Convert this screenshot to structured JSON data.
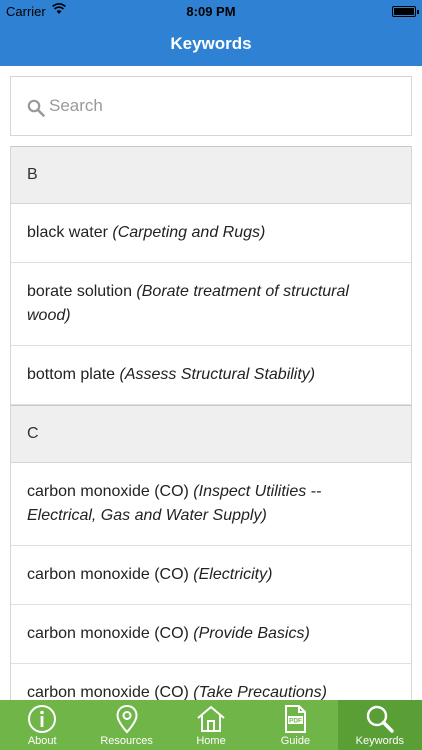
{
  "status_bar": {
    "carrier": "Carrier",
    "time": "8:09 PM"
  },
  "nav": {
    "title": "Keywords"
  },
  "search": {
    "placeholder": "Search"
  },
  "sections": [
    {
      "letter": "B",
      "rows": [
        {
          "term": "black water",
          "context": "(Carpeting and Rugs)"
        },
        {
          "term": "borate solution",
          "context": "(Borate treatment of structural wood)"
        },
        {
          "term": "bottom plate",
          "context": "(Assess Structural Stability)"
        }
      ]
    },
    {
      "letter": "C",
      "rows": [
        {
          "term": "carbon monoxide (CO)",
          "context": "(Inspect Utilities -- Electrical, Gas and Water Supply)"
        },
        {
          "term": "carbon monoxide (CO)",
          "context": "(Electricity)"
        },
        {
          "term": "carbon monoxide (CO)",
          "context": "(Provide Basics)"
        },
        {
          "term": "carbon monoxide (CO)",
          "context": "(Take Precautions)"
        }
      ]
    }
  ],
  "tabs": [
    {
      "label": "About",
      "icon": "info-icon"
    },
    {
      "label": "Resources",
      "icon": "map-pin-icon"
    },
    {
      "label": "Home",
      "icon": "home-icon"
    },
    {
      "label": "Guide",
      "icon": "pdf-icon"
    },
    {
      "label": "Keywords",
      "icon": "search-icon",
      "active": true
    }
  ],
  "colors": {
    "nav": "#2f82d3",
    "tab_bar": "#70b547",
    "tab_active": "#5a9e36"
  }
}
